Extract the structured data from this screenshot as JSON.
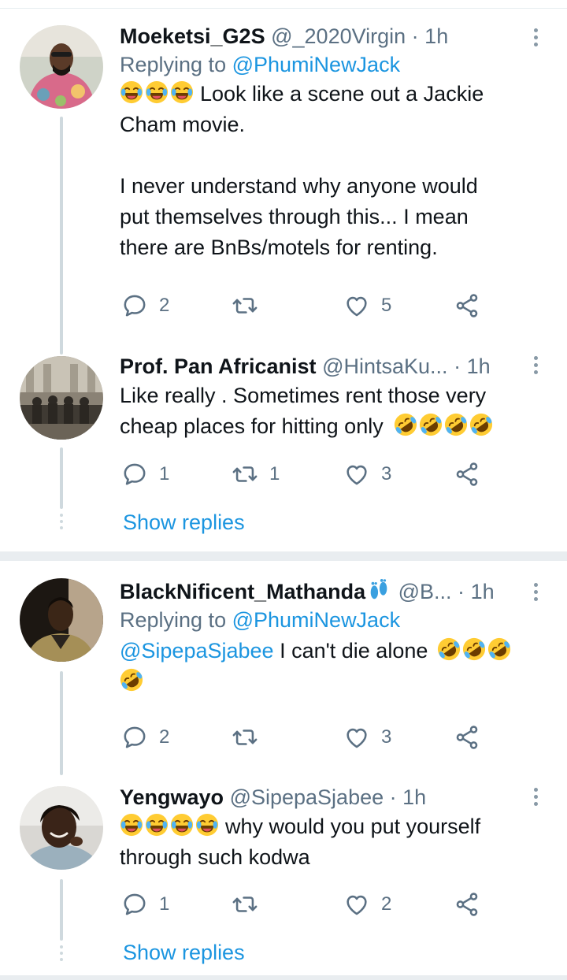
{
  "tweets": [
    {
      "name": "Moeketsi_G2S",
      "handle": "@_2020Virgin",
      "time": "1h",
      "replying_label": "Replying to",
      "replying_to": "@PhumiNewJack",
      "text_line1": "Look like a scene out a Jackie",
      "text_line2": "Cham movie.",
      "text_line3": "I never understand why anyone would",
      "text_line4": "put themselves through this... I mean",
      "text_line5": "there are BnBs/motels for renting.",
      "replies": "2",
      "retweets": "",
      "likes": "5"
    },
    {
      "name": "Prof. Pan Africanist",
      "handle": "@HintsaKu...",
      "time": "1h",
      "text_line1": "Like really . Sometimes rent those very",
      "text_line2": "cheap places for hitting only",
      "replies": "1",
      "retweets": "1",
      "likes": "3",
      "show_replies": "Show replies"
    },
    {
      "name": "BlackNificent_Mathanda",
      "handle": "@B...",
      "time": "1h",
      "replying_label": "Replying to",
      "replying_to": "@PhumiNewJack",
      "mention": "@SipepaSjabee",
      "text_line1": "I can't die alone",
      "replies": "2",
      "retweets": "",
      "likes": "3"
    },
    {
      "name": "Yengwayo",
      "handle": "@SipepaSjabee",
      "time": "1h",
      "text_line1": "why would you put yourself",
      "text_line2": "through such kodwa",
      "replies": "1",
      "retweets": "",
      "likes": "2",
      "show_replies": "Show replies"
    }
  ],
  "colors": {
    "link": "#1b95e0",
    "muted": "#5b7083",
    "thread_line": "#cfd9de"
  },
  "icons": [
    "reply-icon",
    "retweet-icon",
    "like-icon",
    "share-icon",
    "more-icon",
    "laughing-emoji",
    "rofl-emoji",
    "footprints-emoji"
  ]
}
